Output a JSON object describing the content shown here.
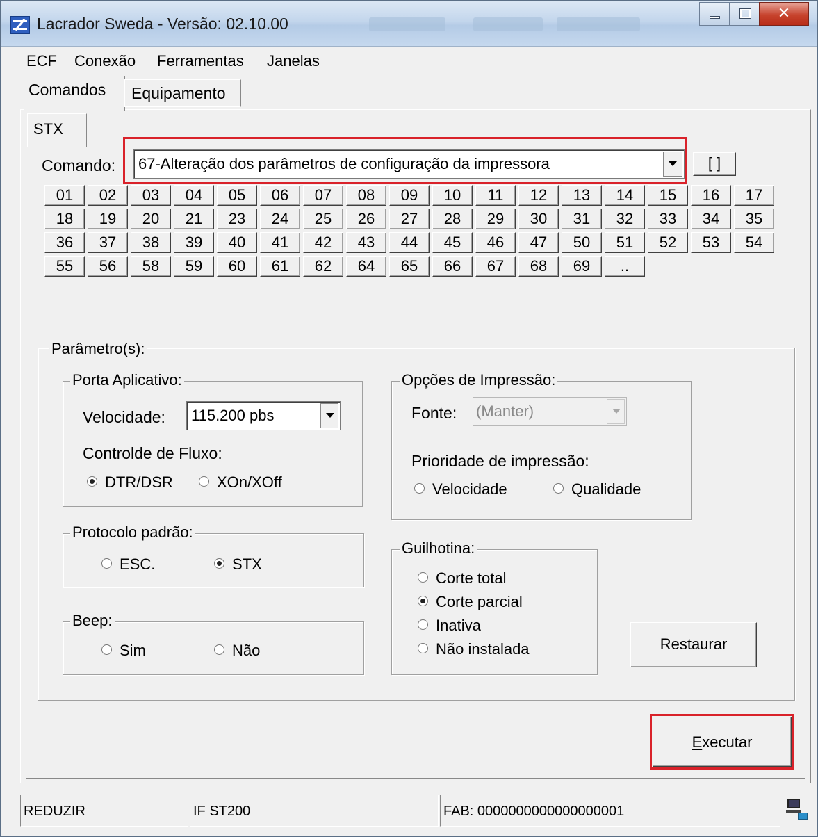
{
  "window": {
    "title": "Lacrador Sweda - Versão: 02.10.00"
  },
  "menu": {
    "items": [
      "ECF",
      "Conexão",
      "Ferramentas",
      "Janelas"
    ]
  },
  "tabs": {
    "outer": [
      "Comandos",
      "Equipamento"
    ],
    "inner": [
      "STX"
    ]
  },
  "command": {
    "label": "Comando:",
    "selected": "67-Alteração dos parâmetros de configuração da impressora",
    "side_button": "[ ]"
  },
  "command_buttons": {
    "row1": [
      "01",
      "02",
      "03",
      "04",
      "05",
      "06",
      "07",
      "08",
      "09",
      "10",
      "11",
      "12",
      "13",
      "14",
      "15",
      "16",
      "17"
    ],
    "row2": [
      "18",
      "19",
      "20",
      "21",
      "23",
      "24",
      "25",
      "26",
      "27",
      "28",
      "29",
      "30",
      "31",
      "32",
      "33",
      "34",
      "35"
    ],
    "row3": [
      "36",
      "37",
      "38",
      "39",
      "40",
      "41",
      "42",
      "43",
      "44",
      "45",
      "46",
      "47",
      "50",
      "51",
      "52",
      "53",
      "54"
    ],
    "row4": [
      "55",
      "56",
      "58",
      "59",
      "60",
      "61",
      "62",
      "64",
      "65",
      "66",
      "67",
      "68",
      "69",
      ".."
    ]
  },
  "parametros": {
    "legend": "Parâmetro(s):",
    "porta": {
      "legend": "Porta Aplicativo:",
      "velocidade_label": "Velocidade:",
      "velocidade_value": "115.200 pbs",
      "fluxo_label": "Controlde de Fluxo:",
      "fluxo_options": [
        {
          "label": "DTR/DSR",
          "checked": true
        },
        {
          "label": "XOn/XOff",
          "checked": false
        }
      ]
    },
    "protocolo": {
      "legend": "Protocolo padrão:",
      "options": [
        {
          "label": "ESC.",
          "checked": false
        },
        {
          "label": "STX",
          "checked": true
        }
      ]
    },
    "beep": {
      "legend": "Beep:",
      "options": [
        {
          "label": "Sim",
          "checked": false
        },
        {
          "label": "Não",
          "checked": false
        }
      ]
    },
    "impressao": {
      "legend": "Opções de Impressão:",
      "fonte_label": "Fonte:",
      "fonte_value": "(Manter)",
      "prioridade_label": "Prioridade de impressão:",
      "prioridade_options": [
        {
          "label": "Velocidade",
          "checked": false
        },
        {
          "label": "Qualidade",
          "checked": false
        }
      ]
    },
    "guilhotina": {
      "legend": "Guilhotina:",
      "options": [
        {
          "label": "Corte total",
          "checked": false
        },
        {
          "label": "Corte parcial",
          "checked": true
        },
        {
          "label": "Inativa",
          "checked": false
        },
        {
          "label": "Não instalada",
          "checked": false
        }
      ]
    },
    "restaurar_label": "Restaurar"
  },
  "executar": {
    "label_prefix": "",
    "label_underlined": "E",
    "label_rest": "xecutar"
  },
  "status": {
    "cells": [
      "REDUZIR",
      "IF ST200",
      "FAB: 0000000000000000001"
    ]
  },
  "colors": {
    "highlight": "#d9222a",
    "titlebar": "#c3d6ec",
    "face": "#f0f0f0"
  },
  "icons": {
    "app": "sweda-logo-icon",
    "tray": "network-computer-icon"
  }
}
